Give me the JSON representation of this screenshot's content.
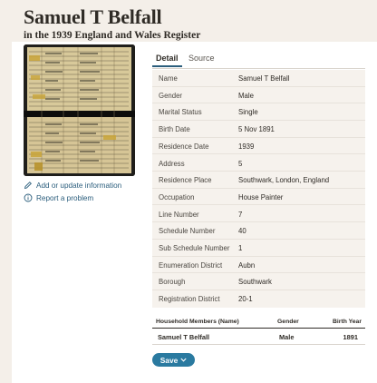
{
  "header": {
    "title": "Samuel T Belfall",
    "subtitle": "in the 1939 England and Wales Register"
  },
  "sidebar": {
    "image_alt": "record image",
    "add_update_label": "Add or update information",
    "report_problem_label": "Report a problem"
  },
  "tabs": [
    {
      "label": "Detail",
      "active": true
    },
    {
      "label": "Source",
      "active": false
    }
  ],
  "details": [
    {
      "label": "Name",
      "value": "Samuel T Belfall"
    },
    {
      "label": "Gender",
      "value": "Male"
    },
    {
      "label": "Marital Status",
      "value": "Single"
    },
    {
      "label": "Birth Date",
      "value": "5 Nov 1891"
    },
    {
      "label": "Residence Date",
      "value": "1939"
    },
    {
      "label": "Address",
      "value": "5"
    },
    {
      "label": "Residence Place",
      "value": "Southwark, London, England"
    },
    {
      "label": "Occupation",
      "value": "House Painter"
    },
    {
      "label": "Line Number",
      "value": "7"
    },
    {
      "label": "Schedule Number",
      "value": "40"
    },
    {
      "label": "Sub Schedule Number",
      "value": "1"
    },
    {
      "label": "Enumeration District",
      "value": "Aubn"
    },
    {
      "label": "Borough",
      "value": "Southwark"
    },
    {
      "label": "Registration District",
      "value": "20-1"
    }
  ],
  "household": {
    "headers": {
      "name": "Household Members (Name)",
      "gender": "Gender",
      "birth_year": "Birth Year"
    },
    "rows": [
      {
        "name": "Samuel T Belfall",
        "gender": "Male",
        "birth_year": "1891"
      }
    ]
  },
  "save_button": {
    "label": "Save"
  },
  "colors": {
    "accent": "#2a7aa0",
    "link": "#2a5d7c",
    "background": "#f4efe9"
  }
}
